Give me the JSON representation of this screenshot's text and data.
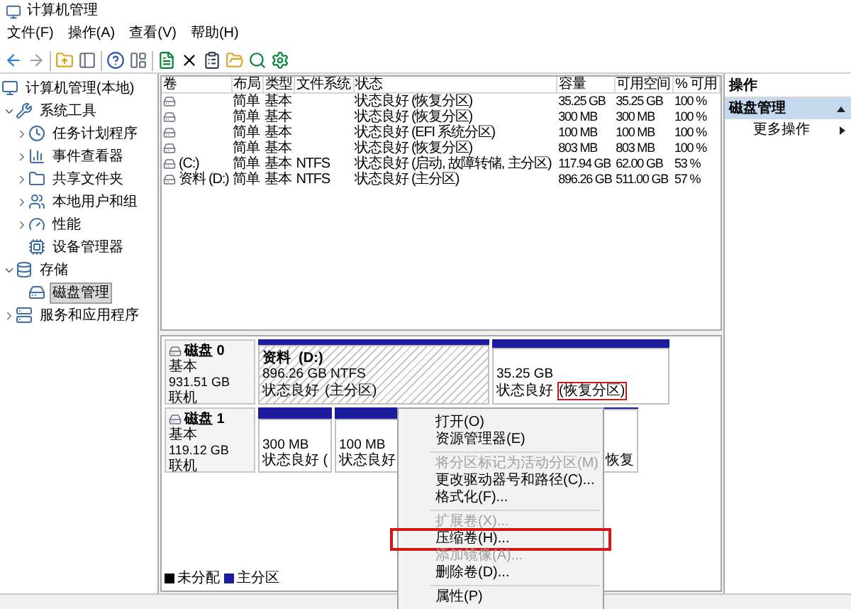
{
  "window": {
    "title": "计算机管理"
  },
  "menu": [
    "文件(F)",
    "操作(A)",
    "查看(V)",
    "帮助(H)"
  ],
  "tree": [
    {
      "label": "计算机管理(本地)",
      "selected": false,
      "children": [
        {
          "label": "系统工具",
          "expanded": true,
          "selected": false,
          "children": [
            {
              "label": "任务计划程序",
              "expanded": false,
              "selected": false
            },
            {
              "label": "事件查看器",
              "expanded": false,
              "selected": false
            },
            {
              "label": "共享文件夹",
              "expanded": false,
              "selected": false
            },
            {
              "label": "本地用户和组",
              "expanded": false,
              "selected": false
            },
            {
              "label": "性能",
              "expanded": false,
              "selected": false
            },
            {
              "label": "设备管理器",
              "selected": false
            }
          ]
        },
        {
          "label": "存储",
          "expanded": true,
          "selected": false,
          "children": [
            {
              "label": "磁盘管理",
              "selected": true
            }
          ]
        },
        {
          "label": "服务和应用程序",
          "expanded": false,
          "selected": false
        }
      ]
    }
  ],
  "table": {
    "columns": [
      "卷",
      "布局",
      "类型",
      "文件系统",
      "状态",
      "容量",
      "可用空间",
      "% 可用"
    ],
    "rows": [
      [
        "",
        "简单",
        "基本",
        "",
        "状态良好 (恢复分区)",
        "35.25 GB",
        "35.25 GB",
        "100 %"
      ],
      [
        "",
        "简单",
        "基本",
        "",
        "状态良好 (恢复分区)",
        "300 MB",
        "300 MB",
        "100 %"
      ],
      [
        "",
        "简单",
        "基本",
        "",
        "状态良好 (EFI 系统分区)",
        "100 MB",
        "100 MB",
        "100 %"
      ],
      [
        "",
        "简单",
        "基本",
        "",
        "状态良好 (恢复分区)",
        "803 MB",
        "803 MB",
        "100 %"
      ],
      [
        "(C:)",
        "简单",
        "基本",
        "NTFS",
        "状态良好 (启动, 故障转储, 主分区)",
        "117.94 GB",
        "62.00 GB",
        "53 %"
      ],
      [
        "资料 (D:)",
        "简单",
        "基本",
        "NTFS",
        "状态良好 (主分区)",
        "896.26 GB",
        "511.00 GB",
        "57 %"
      ]
    ]
  },
  "disks": [
    {
      "name": "磁盘 0",
      "type": "基本",
      "size": "931.51 GB",
      "state": "联机",
      "partitions": [
        {
          "name": "资料  (D:)",
          "size": "896.26 GB NTFS",
          "status": "状态良好",
          "detail": "(主分区)",
          "selected": true,
          "marked": false
        },
        {
          "size": "35.25 GB",
          "status": "状态良好",
          "detail": "(恢复分区)",
          "selected": false,
          "marked": true
        }
      ]
    },
    {
      "name": "磁盘 1",
      "type": "基本",
      "size": "119.12 GB",
      "state": "联机",
      "partitions": [
        {
          "size": "300 MB",
          "status": "状态良好 (",
          "selected": false
        },
        {
          "size": "100 MB",
          "status": "状态良好",
          "selected": false
        },
        {
          "status": "恢复",
          "selected": false
        }
      ]
    }
  ],
  "legend": [
    {
      "label": "未分配",
      "color": "#000000"
    },
    {
      "label": "主分区",
      "color": "#1c1c9c"
    }
  ],
  "actions": {
    "title": "操作",
    "items": [
      {
        "label": "磁盘管理",
        "selected": true,
        "kind": "section"
      },
      {
        "label": "更多操作",
        "selected": false,
        "kind": "submenu"
      }
    ]
  },
  "context_menu": [
    {
      "kind": "item",
      "label": "打开(O)",
      "disabled": false,
      "marked": false
    },
    {
      "kind": "item",
      "label": "资源管理器(E)",
      "disabled": false,
      "marked": false
    },
    {
      "kind": "separator"
    },
    {
      "kind": "item",
      "label": "将分区标记为活动分区(M)",
      "disabled": true,
      "marked": false
    },
    {
      "kind": "item",
      "label": "更改驱动器号和路径(C)...",
      "disabled": false,
      "marked": false
    },
    {
      "kind": "item",
      "label": "格式化(F)...",
      "disabled": false,
      "marked": false
    },
    {
      "kind": "separator"
    },
    {
      "kind": "item",
      "label": "扩展卷(X)...",
      "disabled": true,
      "marked": false
    },
    {
      "kind": "item",
      "label": "压缩卷(H)...",
      "disabled": false,
      "marked": true
    },
    {
      "kind": "item",
      "label": "添加镜像(A)...",
      "disabled": true,
      "marked": false
    },
    {
      "kind": "item",
      "label": "删除卷(D)...",
      "disabled": false,
      "marked": false
    },
    {
      "kind": "separator"
    },
    {
      "kind": "item",
      "label": "属性(P)",
      "disabled": false,
      "marked": false
    }
  ]
}
